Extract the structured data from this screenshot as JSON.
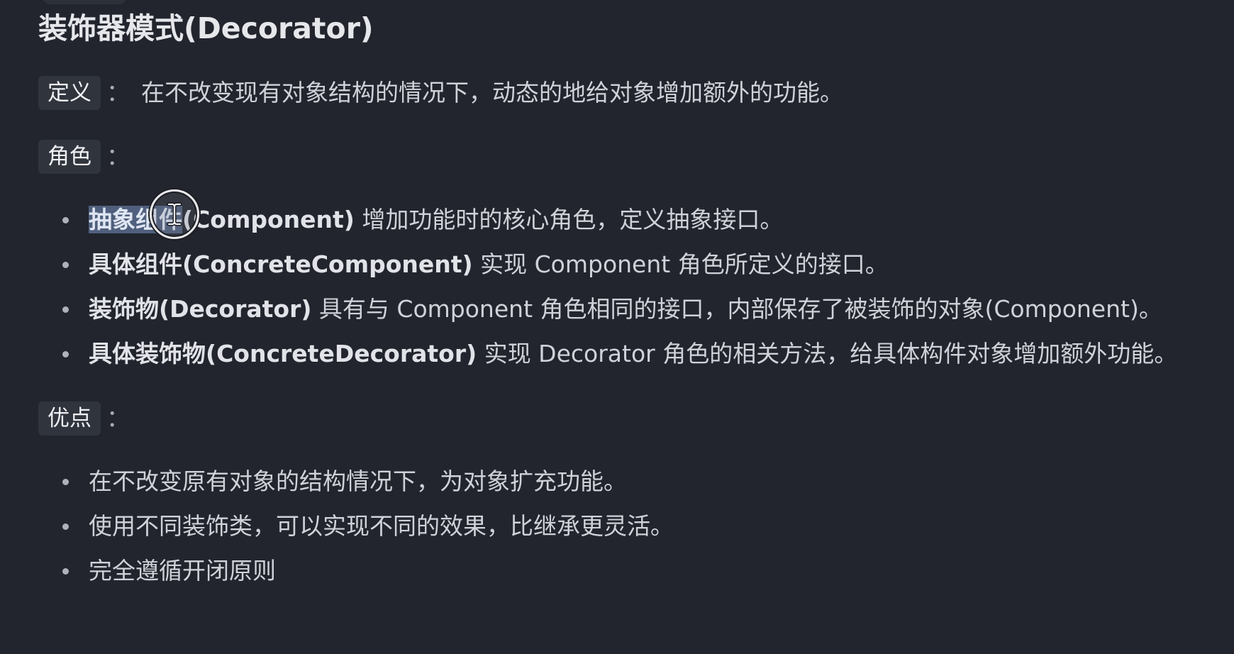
{
  "title": "装饰器模式(Decorator)",
  "definition": {
    "tag": "定义",
    "colon": "：",
    "text": "在不改变现有对象结构的情况下，动态的地给对象增加额外的功能。"
  },
  "roles": {
    "tag": "角色",
    "colon": "：",
    "items": [
      {
        "selected": "抽象组件",
        "term": "(Component)",
        "desc": " 增加功能时的核心角色，定义抽象接口。"
      },
      {
        "term": "具体组件(ConcreteComponent)",
        "desc": " 实现 Component 角色所定义的接口。"
      },
      {
        "term": "装饰物(Decorator)",
        "desc": " 具有与 Component 角色相同的接口，内部保存了被装饰的对象(Component)。"
      },
      {
        "term": "具体装饰物(ConcreteDecorator)",
        "desc": " 实现 Decorator 角色的相关方法，给具体构件对象增加额外功能。"
      }
    ]
  },
  "advantages": {
    "tag": "优点",
    "colon": "：",
    "items": [
      "在不改变原有对象的结构情况下，为对象扩充功能。",
      "使用不同装饰类，可以实现不同的效果，比继承更灵活。",
      "完全遵循开闭原则"
    ]
  },
  "cursor_icon": "text-cursor-icon"
}
